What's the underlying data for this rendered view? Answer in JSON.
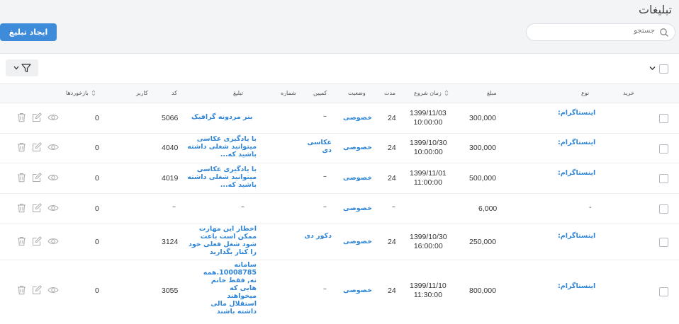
{
  "header": {
    "title": "تبلیغات",
    "create_button": "ایجاد تبلیغ",
    "search_placeholder": "جستجو"
  },
  "columns": {
    "buy": "خرید",
    "type": "نوع",
    "amount": "مبلغ",
    "start_time": "زمان شروع",
    "duration": "مدت",
    "status": "وضعیت",
    "campaign": "کمپین",
    "number": "شماره",
    "ad": "تبلیغ",
    "user": "کاربر",
    "code": "کد",
    "feedbacks": "بازخوردها"
  },
  "rows": [
    {
      "type": "اینستاگرام:",
      "amount": "300,000",
      "date": "1399/11/03",
      "time": "10:00:00",
      "duration": "24",
      "status": "خصوصی",
      "campaign": "–",
      "ad": "بنر مردونه گرافیک",
      "code": "5066",
      "feedbacks": "0"
    },
    {
      "type": "اینستاگرام:",
      "amount": "300,000",
      "date": "1399/10/30",
      "time": "10:00:00",
      "duration": "24",
      "status": "خصوصی",
      "campaign": "عکاسی دی",
      "ad": "با یادگیری عکاسی میتوانید شغلی داشته باشید که...",
      "code": "4040",
      "feedbacks": "0"
    },
    {
      "type": "اینستاگرام:",
      "amount": "500,000",
      "date": "1399/11/01",
      "time": "11:00:00",
      "duration": "24",
      "status": "خصوصی",
      "campaign": "–",
      "ad": "با یادگیری عکاسی میتوانید شغلی داشته باشید که...",
      "code": "4019",
      "feedbacks": "0"
    },
    {
      "type": "-",
      "amount": "6,000",
      "date": "",
      "time": "",
      "duration": "–",
      "status": "خصوصی",
      "campaign": "–",
      "ad": "–",
      "code": "–",
      "feedbacks": "0"
    },
    {
      "type": "اینستاگرام:",
      "amount": "250,000",
      "date": "1399/10/30",
      "time": "16:00:00",
      "duration": "24",
      "status": "خصوصی",
      "campaign": "دکور دی",
      "ad": "اخطار این مهارت ممکن است باعث شود شغل فعلی خود را کنار بگذارید",
      "code": "3124",
      "feedbacks": "0"
    },
    {
      "type": "اینستاگرام:",
      "amount": "800,000",
      "date": "1399/11/10",
      "time": "11:30:00",
      "duration": "24",
      "status": "خصوصی",
      "campaign": "–",
      "ad": "سامانه 10008785.همه نه, فقط خانم هایی که میخواهند استقلال مالی داشته باشند",
      "code": "3055",
      "feedbacks": "0"
    }
  ]
}
